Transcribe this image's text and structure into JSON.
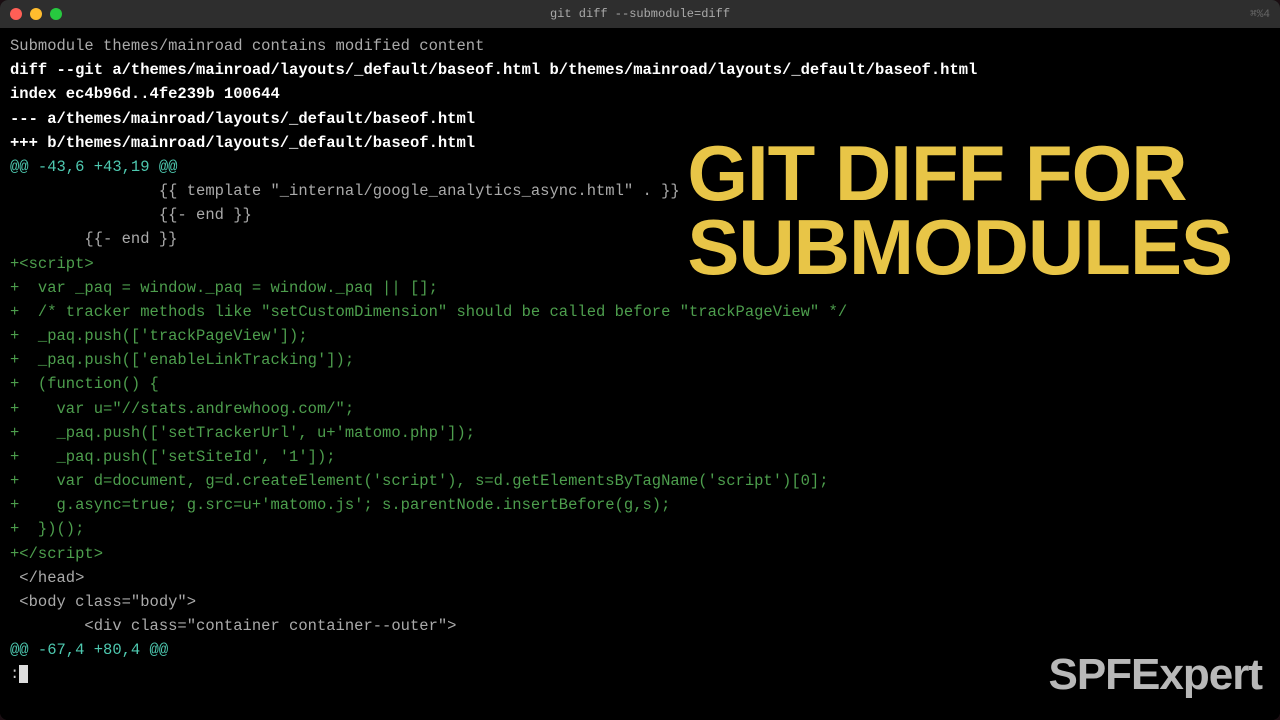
{
  "window": {
    "title": "git diff --submodule=diff",
    "right_indicator": "⌘%4"
  },
  "overlay": {
    "line1": "GIT DIFF FOR",
    "line2": "SUBMODULES"
  },
  "watermark": "SPFExpert",
  "diff": {
    "submodule_notice": "Submodule themes/mainroad contains modified content",
    "diff_header": "diff --git a/themes/mainroad/layouts/_default/baseof.html b/themes/mainroad/layouts/_default/baseof.html",
    "index_line": "index ec4b96d..4fe239b 100644",
    "old_file": "--- a/themes/mainroad/layouts/_default/baseof.html",
    "new_file": "+++ b/themes/mainroad/layouts/_default/baseof.html",
    "hunk1": "@@ -43,6 +43,19 @@",
    "ctx1": "                {{ template \"_internal/google_analytics_async.html\" . }}",
    "ctx2": "                {{- end }}",
    "ctx3": "        {{- end }}",
    "add1": "+<script>",
    "add2": "+  var _paq = window._paq = window._paq || [];",
    "add3": "+  /* tracker methods like \"setCustomDimension\" should be called before \"trackPageView\" */",
    "add4": "+  _paq.push(['trackPageView']);",
    "add5": "+  _paq.push(['enableLinkTracking']);",
    "add6": "+  (function() {",
    "add7": "+    var u=\"//stats.andrewhoog.com/\";",
    "add8": "+    _paq.push(['setTrackerUrl', u+'matomo.php']);",
    "add9": "+    _paq.push(['setSiteId', '1']);",
    "add10": "+    var d=document, g=d.createElement('script'), s=d.getElementsByTagName('script')[0];",
    "add11": "+    g.async=true; g.src=u+'matomo.js'; s.parentNode.insertBefore(g,s);",
    "add12": "+  })();",
    "add13": "+</script>",
    "ctx4": " </head>",
    "ctx5": " <body class=\"body\">",
    "ctx6": "        <div class=\"container container--outer\">",
    "hunk2": "@@ -67,4 +80,4 @@",
    "prompt": ":"
  }
}
